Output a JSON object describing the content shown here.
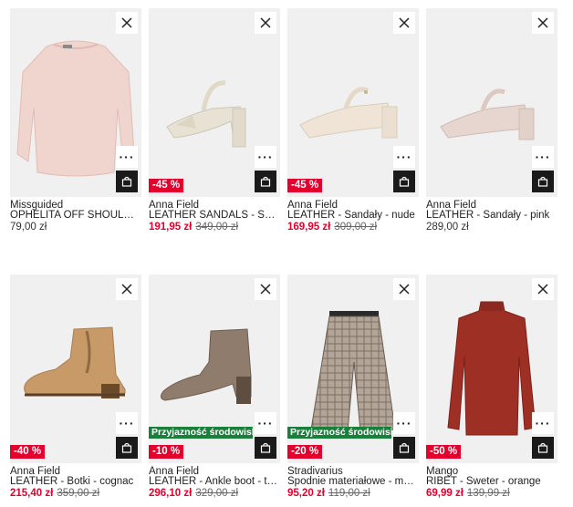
{
  "products": [
    {
      "brand": "Missguided",
      "name": "OPHELITA OFF SHOULDER - Sweter - pink",
      "price": "79,00 zł",
      "old_price": "",
      "discount": "",
      "eco": "",
      "sale": false
    },
    {
      "brand": "Anna Field",
      "name": "LEATHER SANDALS - Sandały - ecru",
      "price": "191,95 zł",
      "old_price": "349,00 zł",
      "discount": "-45 %",
      "eco": "",
      "sale": true
    },
    {
      "brand": "Anna Field",
      "name": "LEATHER - Sandały - nude",
      "price": "169,95 zł",
      "old_price": "309,00 zł",
      "discount": "-45 %",
      "eco": "",
      "sale": true
    },
    {
      "brand": "Anna Field",
      "name": "LEATHER - Sandały - pink",
      "price": "289,00 zł",
      "old_price": "",
      "discount": "",
      "eco": "",
      "sale": false
    },
    {
      "brand": "Anna Field",
      "name": "LEATHER - Botki - cognac",
      "price": "215,40 zł",
      "old_price": "359,00 zł",
      "discount": "-40 %",
      "eco": "",
      "sale": true
    },
    {
      "brand": "Anna Field",
      "name": "LEATHER - Ankle boot - taupe",
      "price": "296,10 zł",
      "old_price": "329,00 zł",
      "discount": "-10 %",
      "eco": "Przyjazność środowisku",
      "sale": true
    },
    {
      "brand": "Stradivarius",
      "name": "Spodnie materiałowe - multicoloured",
      "price": "95,20 zł",
      "old_price": "119,00 zł",
      "discount": "-20 %",
      "eco": "Przyjazność środowisku",
      "sale": true
    },
    {
      "brand": "Mango",
      "name": "RIBET - Sweter - orange",
      "price": "69,99 zł",
      "old_price": "139,99 zł",
      "discount": "-50 %",
      "eco": "",
      "sale": true
    }
  ],
  "icons": {
    "close": "close-icon",
    "more": "more-dots-icon",
    "bag": "shopping-bag-icon"
  },
  "more_label": "···",
  "colors": {
    "sale": "#e3002c",
    "eco": "#1b7f3c",
    "bag_button": "#1a1a1a"
  }
}
